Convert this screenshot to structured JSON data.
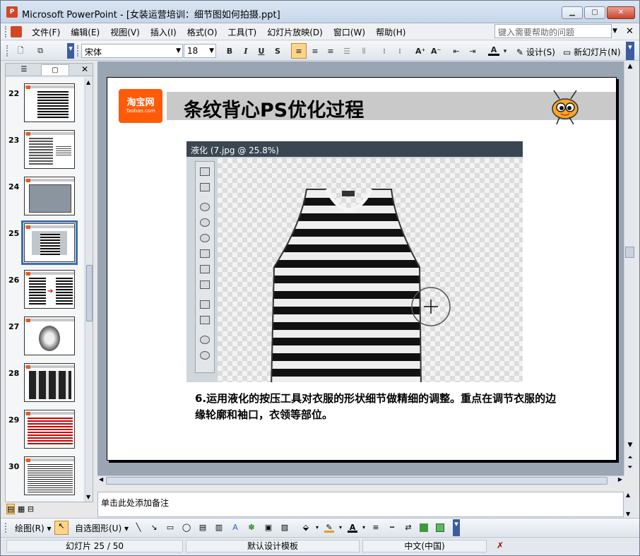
{
  "window": {
    "title": "Microsoft PowerPoint - [女装运营培训：细节图如何拍摄.ppt]",
    "app_icon_letter": "P"
  },
  "menu": {
    "items": [
      "文件(F)",
      "编辑(E)",
      "视图(V)",
      "插入(I)",
      "格式(O)",
      "工具(T)",
      "幻灯片放映(D)",
      "窗口(W)",
      "帮助(H)"
    ],
    "help_placeholder": "键入需要帮助的问题"
  },
  "toolbar": {
    "font_name": "宋体",
    "font_size": "18",
    "bold": "B",
    "italic": "I",
    "underline": "U",
    "shadow": "S",
    "design_label": "设计(S)",
    "new_slide_label": "新幻灯片(N)"
  },
  "thumbnails": [
    {
      "number": "22"
    },
    {
      "number": "23"
    },
    {
      "number": "24"
    },
    {
      "number": "25",
      "selected": true
    },
    {
      "number": "26"
    },
    {
      "number": "27"
    },
    {
      "number": "28"
    },
    {
      "number": "29"
    },
    {
      "number": "30"
    }
  ],
  "slide": {
    "logo_line1": "淘宝网",
    "logo_line2": "Taobao.com",
    "title": "条纹背心PS优化过程",
    "photo_window_title": "液化 (7.jpg @ 25.8%)",
    "caption": "6.运用液化的按压工具对衣服的形状细节做精细的调整。重点在调节衣服的边缘轮廓和袖口，衣领等部位。"
  },
  "notes": {
    "placeholder": "单击此处添加备注"
  },
  "drawing_toolbar": {
    "draw_label": "绘图(R)",
    "autoshapes_label": "自选图形(U)"
  },
  "status": {
    "slide_position": "幻灯片 25 / 50",
    "template": "默认设计模板",
    "language": "中文(中国)"
  },
  "colors": {
    "selection": "#3f6fb0",
    "taobao_orange": "#ff5a0a",
    "title_band": "#c9c9c9"
  }
}
